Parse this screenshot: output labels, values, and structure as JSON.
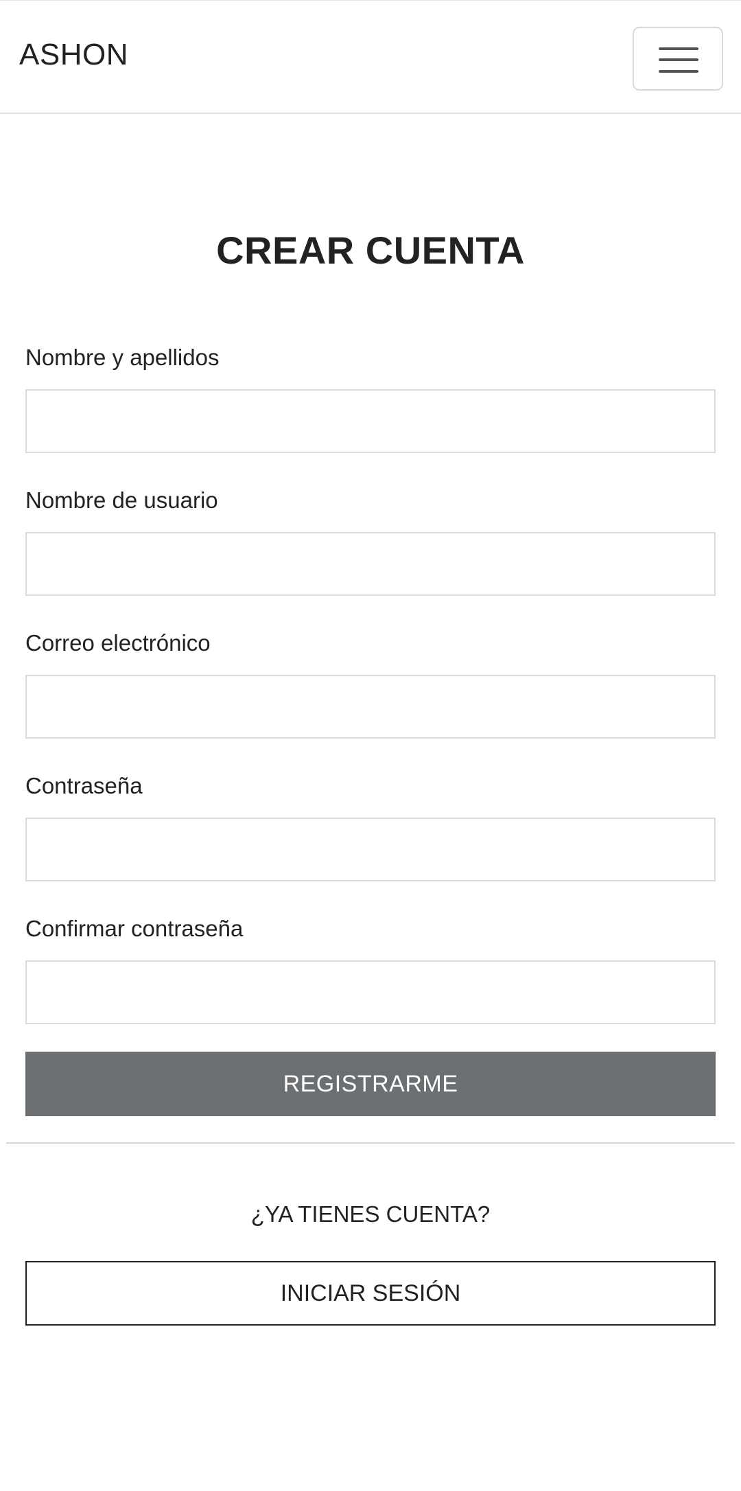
{
  "navbar": {
    "brand": "ASHON",
    "menu_icon": "hamburger-menu-icon"
  },
  "form": {
    "title": "CREAR CUENTA",
    "fields": [
      {
        "label": "Nombre y apellidos",
        "value": "",
        "placeholder": ""
      },
      {
        "label": "Nombre de usuario",
        "value": "",
        "placeholder": ""
      },
      {
        "label": "Correo electrónico",
        "value": "",
        "placeholder": ""
      },
      {
        "label": "Contraseña",
        "value": "",
        "placeholder": ""
      },
      {
        "label": "Confirmar contraseña",
        "value": "",
        "placeholder": ""
      }
    ],
    "submit_label": "REGISTRARME",
    "submit_color": "#6c6f72"
  },
  "login": {
    "question": "¿YA TIENES CUENTA?",
    "button_label": "INICIAR SESIÓN"
  }
}
